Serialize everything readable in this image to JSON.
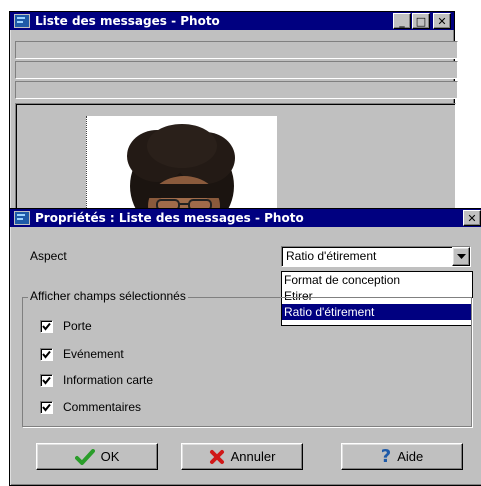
{
  "bg_window": {
    "title": "Liste des messages - Photo",
    "controls": {
      "minimize": "_",
      "maximize": "□",
      "close": "✕"
    }
  },
  "dialog": {
    "title": "Propriétés : Liste des messages - Photo",
    "close": "✕",
    "aspect_label": "Aspect",
    "aspect_value": "Ratio d'étirement",
    "dropdown_options": [
      "Format de conception",
      "Etirer",
      "Ratio d'étirement"
    ],
    "selected_option": "Ratio d'étirement",
    "group_label": "Afficher champs sélectionnés",
    "checkboxes": [
      {
        "label": "Porte",
        "checked": true
      },
      {
        "label": "Evénement",
        "checked": true
      },
      {
        "label": "Information carte",
        "checked": true
      },
      {
        "label": "Commentaires",
        "checked": true
      }
    ],
    "buttons": {
      "ok": "OK",
      "cancel": "Annuler",
      "help": "Aide"
    }
  },
  "colors": {
    "titlebar": "#000080",
    "face": "#c0c0c0",
    "highlight": "#000080",
    "ok_check": "#2a9d2a",
    "cancel_x": "#d01818",
    "help_q": "#1e5aa8"
  }
}
